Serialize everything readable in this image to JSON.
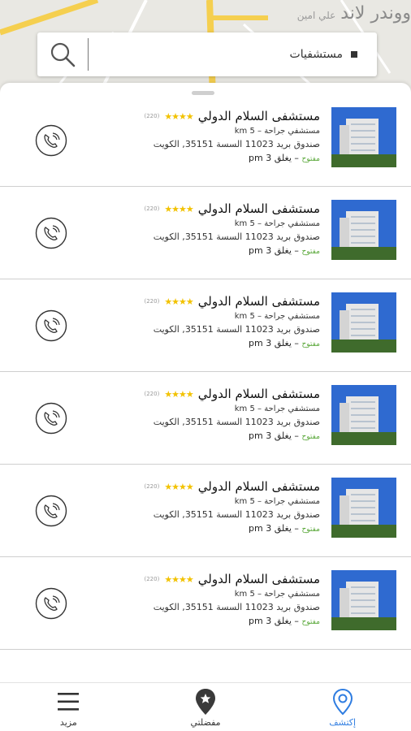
{
  "map": {
    "label_main": "ووندر لاند",
    "label_small": "علي امين"
  },
  "search": {
    "query": "مستشفيات",
    "icon": "search-icon"
  },
  "results": [
    {
      "name": "مستشفى السلام الدولي",
      "rating": 4,
      "review_count": "(220)",
      "distance": "5 km",
      "category": "مستشفي جراحة",
      "address": "صندوق بريد 11023 السسة 35151, الكويت",
      "status": "مفتوح",
      "hours": "يغلق 3 pm"
    },
    {
      "name": "مستشفى السلام الدولي",
      "rating": 4,
      "review_count": "(220)",
      "distance": "5 km",
      "category": "مستشفي جراحة",
      "address": "صندوق بريد 11023 السسة 35151, الكويت",
      "status": "مفتوح",
      "hours": "يغلق 3 pm"
    },
    {
      "name": "مستشفى السلام الدولي",
      "rating": 4,
      "review_count": "(220)",
      "distance": "5 km",
      "category": "مستشفي جراحة",
      "address": "صندوق بريد 11023 السسة 35151, الكويت",
      "status": "مفتوح",
      "hours": "يغلق 3 pm"
    },
    {
      "name": "مستشفى السلام الدولي",
      "rating": 4,
      "review_count": "(220)",
      "distance": "5 km",
      "category": "مستشفي جراحة",
      "address": "صندوق بريد 11023 السسة 35151, الكويت",
      "status": "مفتوح",
      "hours": "يغلق 3 pm"
    },
    {
      "name": "مستشفى السلام الدولي",
      "rating": 4,
      "review_count": "(220)",
      "distance": "5 km",
      "category": "مستشفي جراحة",
      "address": "صندوق بريد 11023 السسة 35151, الكويت",
      "status": "مفتوح",
      "hours": "يغلق 3 pm"
    },
    {
      "name": "مستشفى السلام الدولي",
      "rating": 4,
      "review_count": "(220)",
      "distance": "5 km",
      "category": "مستشفي جراحة",
      "address": "صندوق بريد 11023 السسة 35151, الكويت",
      "status": "مفتوح",
      "hours": "يغلق 3 pm"
    }
  ],
  "colors": {
    "accent": "#2f7de1",
    "star": "#f2c200",
    "open": "#5aa83a"
  },
  "nav": [
    {
      "label": "إكتشف",
      "icon": "location-pin-icon",
      "active": true
    },
    {
      "label": "مفضلتي",
      "icon": "star-pin-icon",
      "active": false
    },
    {
      "label": "مزيد",
      "icon": "menu-icon",
      "active": false
    }
  ]
}
